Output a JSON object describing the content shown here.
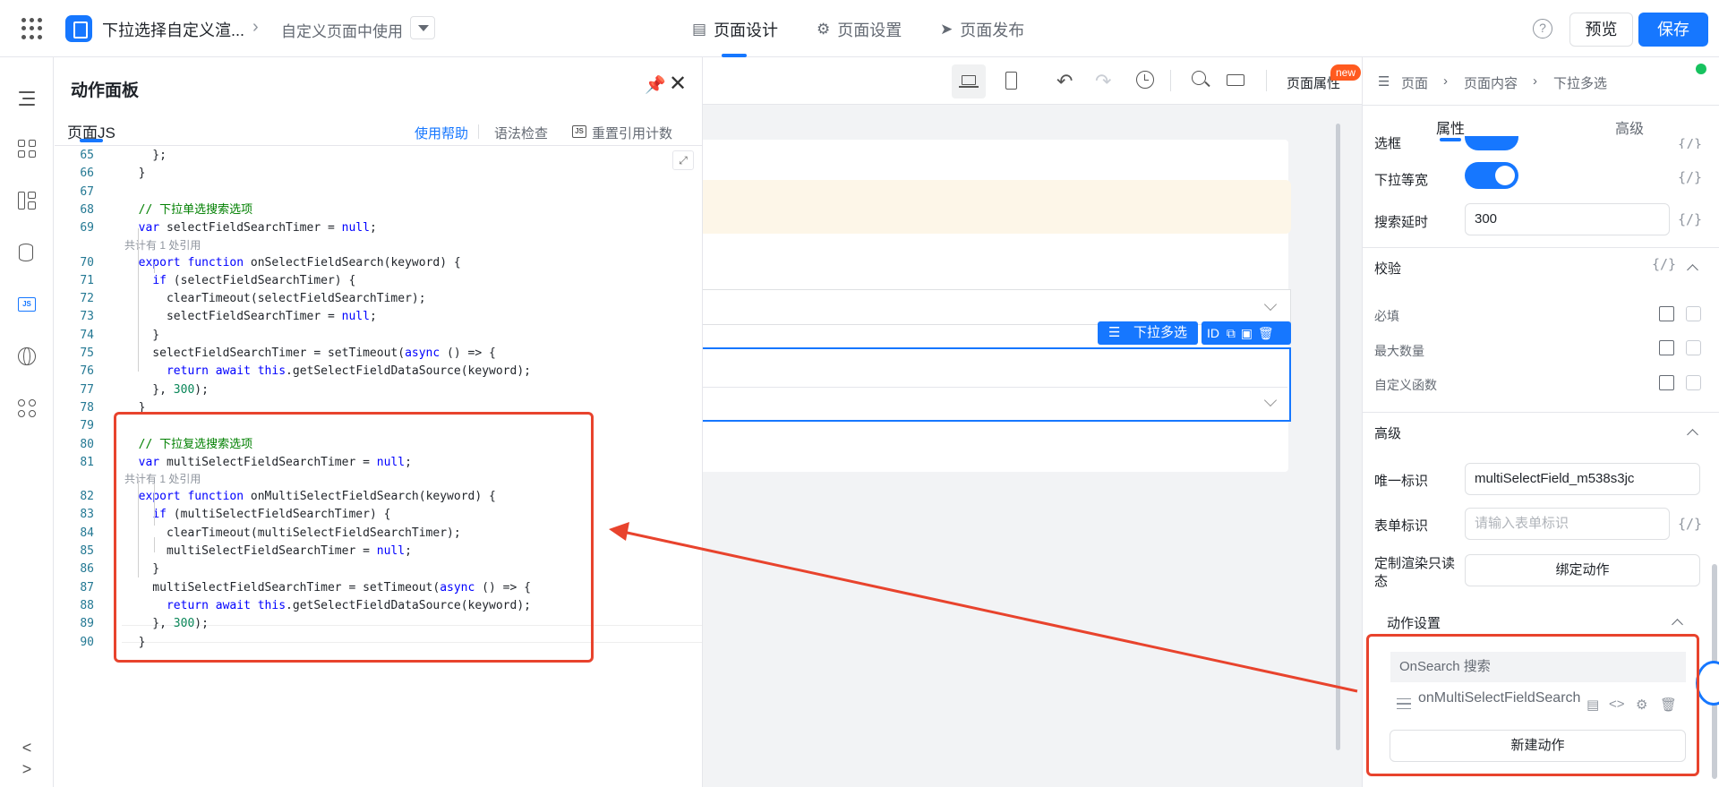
{
  "header": {
    "app_title": "下拉选择自定义渲...",
    "page_title": "自定义页面中使用",
    "tabs": [
      {
        "label": "页面设计",
        "icon": "layout-icon"
      },
      {
        "label": "页面设置",
        "icon": "gear-icon"
      },
      {
        "label": "页面发布",
        "icon": "send-icon"
      }
    ],
    "help": "?",
    "preview_label": "预览",
    "save_label": "保存"
  },
  "action_panel": {
    "title": "动作面板",
    "tab": "页面JS",
    "help_link": "使用帮助",
    "syntax_check": "语法检查",
    "reset_ref": "重置引用计数",
    "js_badge": "JS"
  },
  "code": {
    "lines": [
      {
        "n": "65",
        "text": "    };"
      },
      {
        "n": "66",
        "text": "  }"
      },
      {
        "n": "67",
        "text": ""
      },
      {
        "n": "68",
        "text": "  // 下拉单选搜索选项"
      },
      {
        "n": "69",
        "text": "  var selectFieldSearchTimer = null;"
      },
      {
        "n": "70",
        "text": "  export function onSelectFieldSearch(keyword) {"
      },
      {
        "n": "71",
        "text": "    if (selectFieldSearchTimer) {"
      },
      {
        "n": "72",
        "text": "      clearTimeout(selectFieldSearchTimer);"
      },
      {
        "n": "73",
        "text": "      selectFieldSearchTimer = null;"
      },
      {
        "n": "74",
        "text": "    }"
      },
      {
        "n": "75",
        "text": "    selectFieldSearchTimer = setTimeout(async () => {"
      },
      {
        "n": "76",
        "text": "      return await this.getSelectFieldDataSource(keyword);"
      },
      {
        "n": "77",
        "text": "    }, 300);"
      },
      {
        "n": "78",
        "text": "  }"
      },
      {
        "n": "79",
        "text": ""
      },
      {
        "n": "80",
        "text": "  // 下拉复选搜索选项"
      },
      {
        "n": "81",
        "text": "  var multiSelectFieldSearchTimer = null;"
      },
      {
        "n": "82",
        "text": "  export function onMultiSelectFieldSearch(keyword) {"
      },
      {
        "n": "83",
        "text": "    if (multiSelectFieldSearchTimer) {"
      },
      {
        "n": "84",
        "text": "      clearTimeout(multiSelectFieldSearchTimer);"
      },
      {
        "n": "85",
        "text": "      multiSelectFieldSearchTimer = null;"
      },
      {
        "n": "86",
        "text": "    }"
      },
      {
        "n": "87",
        "text": "    multiSelectFieldSearchTimer = setTimeout(async () => {"
      },
      {
        "n": "88",
        "text": "      return await this.getSelectFieldDataSource(keyword);"
      },
      {
        "n": "89",
        "text": "    }, 300);"
      },
      {
        "n": "90",
        "text": "  }"
      }
    ],
    "codelens_label": "共计有 1 处引用"
  },
  "canvas": {
    "page_attr": "页面属性",
    "new_badge": "new",
    "component_tag": "下拉多选",
    "id_label": "ID"
  },
  "right_panel": {
    "breadcrumb": [
      "页面",
      "页面内容",
      "下拉多选"
    ],
    "tabs": [
      "属性",
      "高级"
    ],
    "cut_label": "选框",
    "dropdown_equal_width": "下拉等宽",
    "search_delay_label": "搜索延时",
    "search_delay_value": "300",
    "fx": "{/}",
    "validation_title": "校验",
    "required": "必填",
    "max_count": "最大数量",
    "custom_func": "自定义函数",
    "advanced_title": "高级",
    "unique_id_label": "唯一标识",
    "unique_id_value": "multiSelectField_m538s3jc",
    "form_id_label": "表单标识",
    "form_id_placeholder": "请输入表单标识",
    "readonly_render_label": "定制渲染只读态",
    "bind_action": "绑定动作",
    "action_settings": "动作设置",
    "event_name": "OnSearch 搜索",
    "handler": "onMultiSelectFieldSearch",
    "new_action": "新建动作"
  },
  "colors": {
    "accent": "#1677ff",
    "annotation": "#e8432d",
    "toggle": "#1677ff"
  }
}
